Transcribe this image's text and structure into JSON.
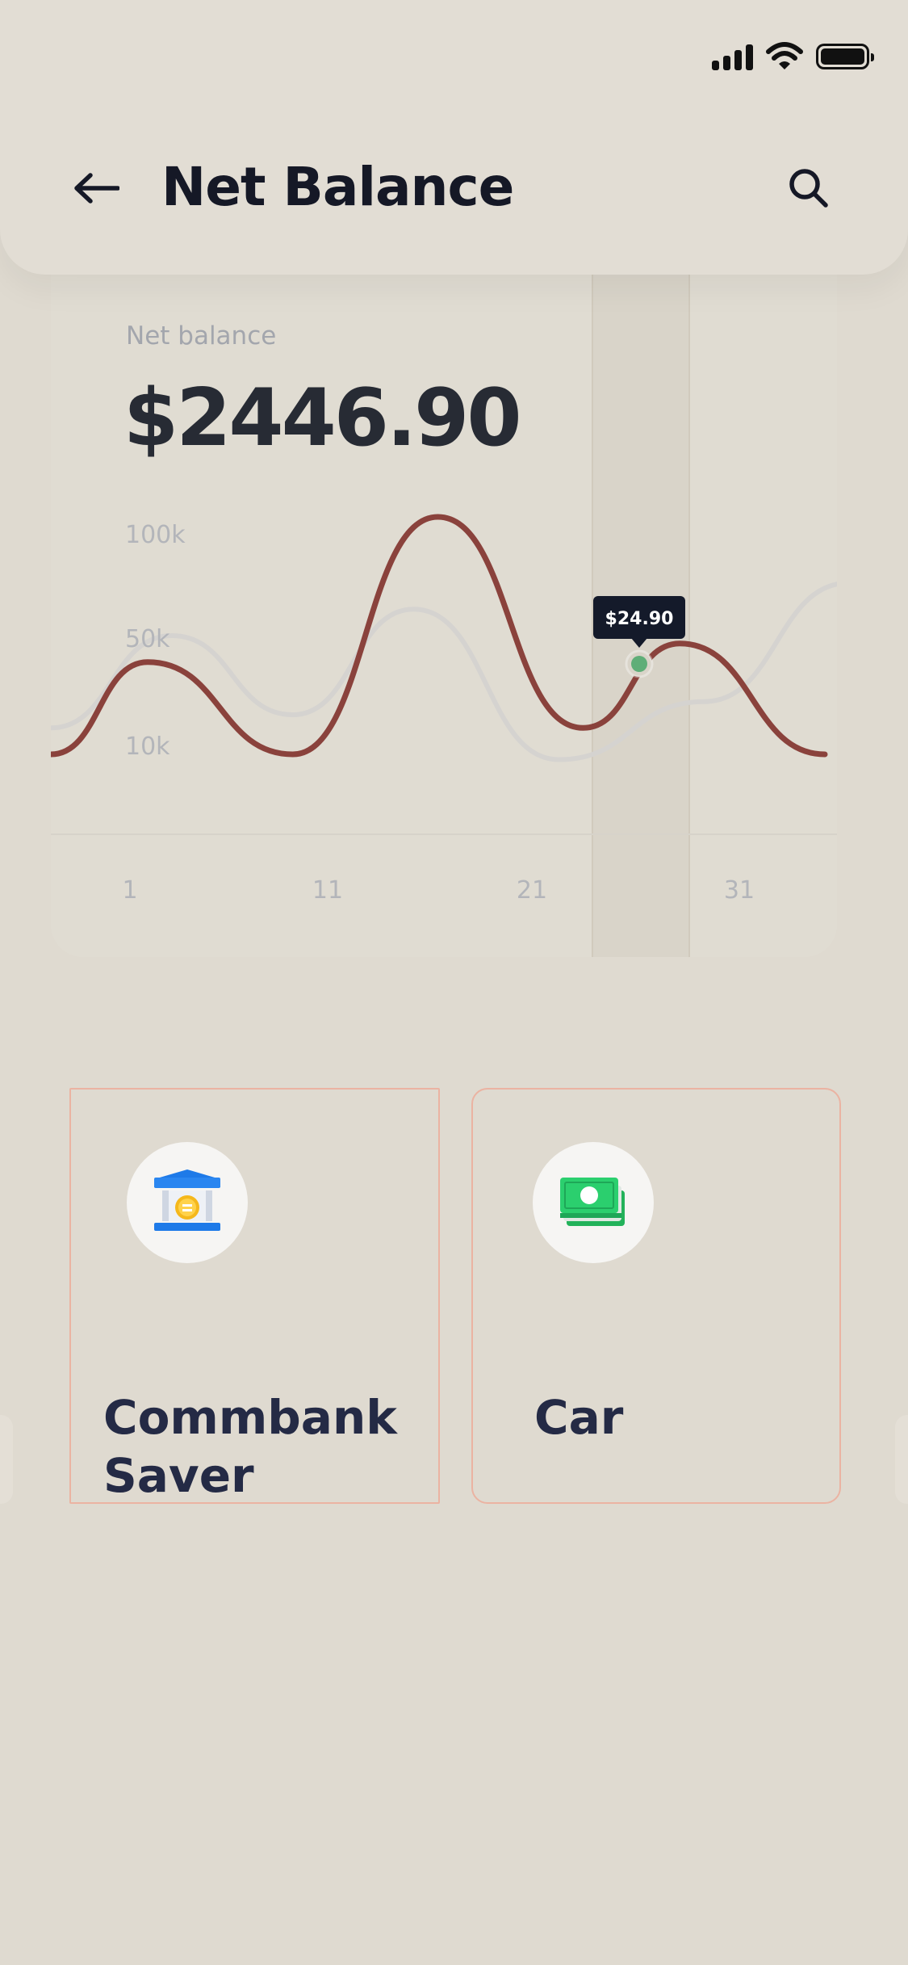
{
  "header": {
    "title": "Net Balance",
    "back_icon": "arrow-left-icon",
    "search_icon": "search-icon"
  },
  "status_bar": {
    "signal_icon": "cellular-signal-icon",
    "wifi_icon": "wifi-icon",
    "battery_icon": "battery-icon"
  },
  "balance": {
    "label": "Net balance",
    "value": "$2446.90"
  },
  "chart_data": {
    "type": "line",
    "x_ticks": [
      "1",
      "11",
      "21",
      "31"
    ],
    "y_ticks": [
      "100k",
      "50k",
      "10k"
    ],
    "grid": false,
    "series": [
      {
        "color": "#8a423c",
        "x": [
          0,
          4,
          10,
          16,
          22,
          26,
          32
        ],
        "y": [
          10,
          45,
          10,
          100,
          20,
          52,
          10
        ]
      },
      {
        "color": "#d5d3d0",
        "x": [
          0,
          5,
          10,
          15,
          21,
          27,
          33
        ],
        "y": [
          20,
          55,
          25,
          65,
          8,
          30,
          75
        ]
      }
    ],
    "tooltip": {
      "label": "$24.90"
    },
    "highlight_color": "#5fae78"
  },
  "accounts": [
    {
      "name": "Commbank Saver",
      "icon": "bank-coin-icon"
    },
    {
      "name": "Car",
      "icon": "cash-stack-icon"
    }
  ]
}
